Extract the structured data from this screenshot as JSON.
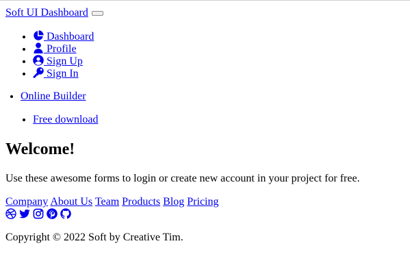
{
  "navbar": {
    "brand": "Soft UI Dashboard",
    "items": [
      {
        "label": "Dashboard",
        "icon": "chart-pie-icon"
      },
      {
        "label": "Profile",
        "icon": "user-icon"
      },
      {
        "label": "Sign Up",
        "icon": "user-circle-icon"
      },
      {
        "label": "Sign In",
        "icon": "key-icon"
      }
    ],
    "builder": "Online Builder",
    "download": "Free download"
  },
  "hero": {
    "title": "Welcome!",
    "lead": "Use these awesome forms to login or create new account in your project for free."
  },
  "footer": {
    "links": [
      "Company",
      "About Us",
      "Team",
      "Products",
      "Blog",
      "Pricing"
    ],
    "social": [
      "dribbble-icon",
      "twitter-icon",
      "instagram-icon",
      "pinterest-icon",
      "github-icon"
    ],
    "copyright": "Copyright © 2022 Soft by Creative Tim."
  },
  "colors": {
    "link": "#0000ee",
    "text": "#000000"
  }
}
